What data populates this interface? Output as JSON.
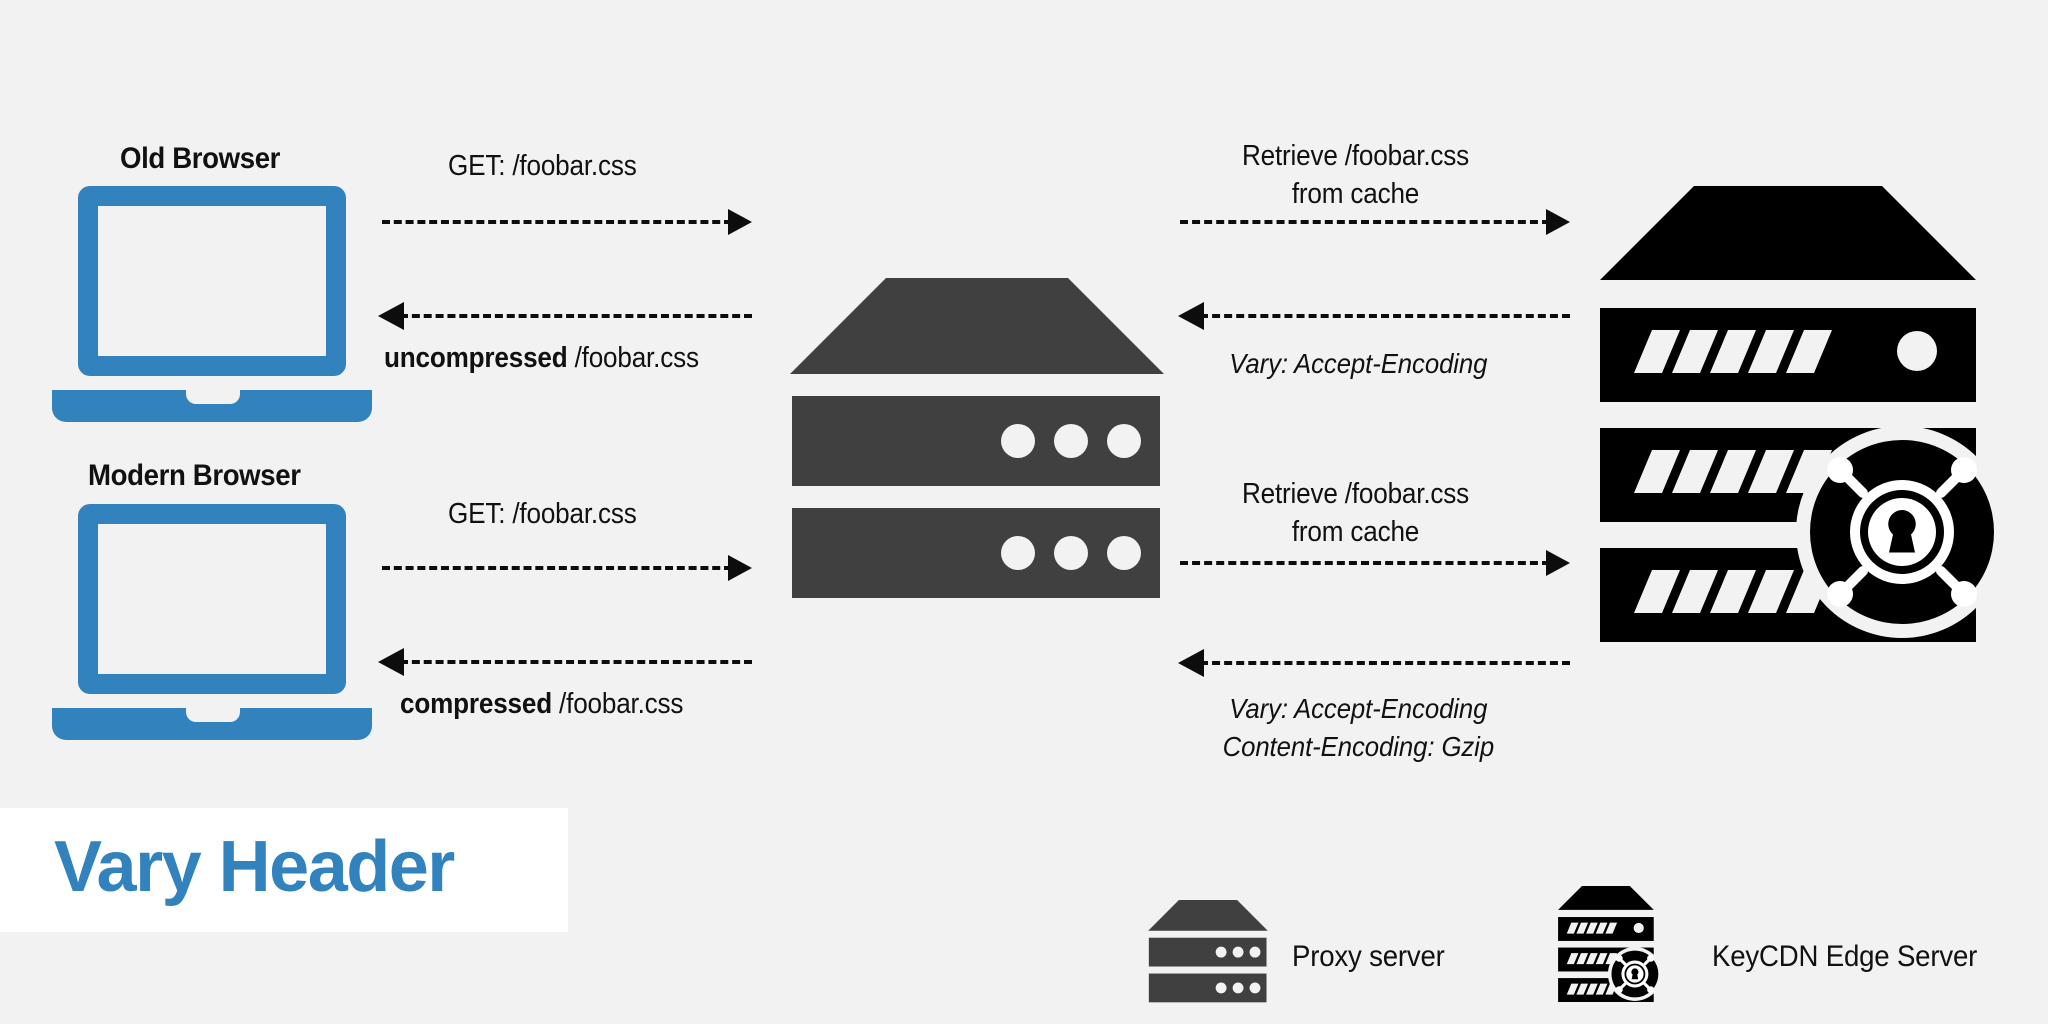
{
  "meta": {
    "title": "Vary Header",
    "background_color": "#f2f2f2",
    "accent_color": "#3182bd",
    "proxy_color": "#404040",
    "edge_color": "#000000"
  },
  "title_block": {
    "label": "Vary Header"
  },
  "nodes": {
    "old_browser": {
      "label": "Old Browser",
      "icon": "laptop-icon"
    },
    "modern_browser": {
      "label": "Modern Browser",
      "icon": "laptop-icon"
    },
    "proxy_server": {
      "label": "Proxy server",
      "icon": "proxy-server-icon"
    },
    "edge_server": {
      "label": "KeyCDN Edge Server",
      "icon": "keycdn-edge-server-icon"
    }
  },
  "flows": {
    "old_request": {
      "label": "GET: /foobar.css",
      "direction": "right"
    },
    "old_response": {
      "emphasis": "uncompressed",
      "rest": " /foobar.css",
      "direction": "left"
    },
    "modern_request": {
      "label": "GET: /foobar.css",
      "direction": "right"
    },
    "modern_response": {
      "emphasis": "compressed",
      "rest": " /foobar.css",
      "direction": "left"
    },
    "upstream_request_top": {
      "line1": "Retrieve /foobar.css",
      "line2": "from cache",
      "direction": "right"
    },
    "upstream_response_top": {
      "line1": "Vary: Accept-Encoding",
      "direction": "left"
    },
    "upstream_request_bottom": {
      "line1": "Retrieve /foobar.css",
      "line2": "from cache",
      "direction": "right"
    },
    "upstream_response_bottom": {
      "line1": "Vary: Accept-Encoding",
      "line2": "Content-Encoding: Gzip",
      "direction": "left"
    }
  },
  "legend": {
    "items": [
      {
        "icon": "proxy-server-icon",
        "label": "Proxy server"
      },
      {
        "icon": "keycdn-edge-server-icon",
        "label": "KeyCDN Edge Server"
      }
    ]
  }
}
